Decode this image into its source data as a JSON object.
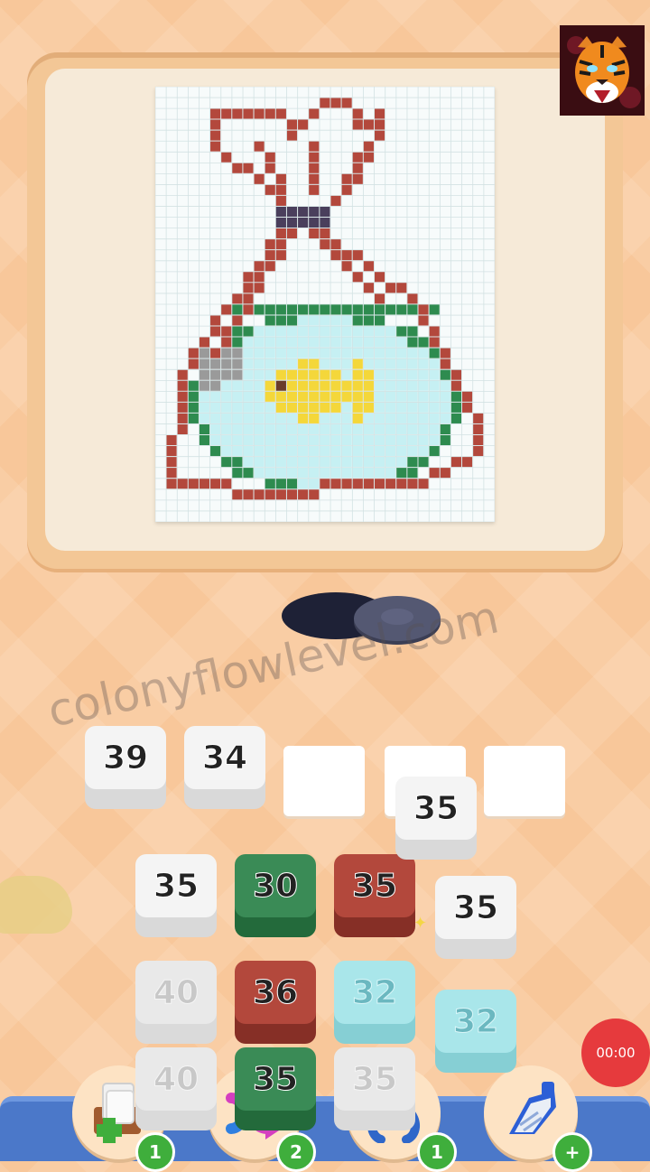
{
  "board": {
    "grid_cols": 31,
    "grid_rows": 40,
    "colors": {
      "background": "#f7fbfb",
      "outline": "#b3483c",
      "knot": "#4a3f5c",
      "water_edge": "#2e8b4f",
      "water": "#c6f0f3",
      "fish": "#f4d73a",
      "eye": "#6a3c2a",
      "question": "#9a9a9a"
    }
  },
  "avatar": {
    "icon": "tiger-icon"
  },
  "slots": [
    {
      "value": "39",
      "color": "white"
    },
    {
      "value": "34",
      "color": "white"
    },
    {
      "value": "",
      "color": "empty"
    },
    {
      "value": "",
      "color": "empty"
    },
    {
      "value": "",
      "color": "empty"
    }
  ],
  "floating_tile": {
    "value": "35",
    "color": "white"
  },
  "pile": {
    "row1": [
      {
        "value": "35",
        "color": "white"
      },
      {
        "value": "30",
        "color": "green"
      },
      {
        "value": "35",
        "color": "red"
      },
      {
        "value": "35",
        "color": "white"
      }
    ],
    "row2": [
      {
        "value": "40",
        "color": "light"
      },
      {
        "value": "36",
        "color": "red"
      },
      {
        "value": "32",
        "color": "cyan"
      },
      {
        "value": "32",
        "color": "cyan"
      }
    ],
    "row3": [
      {
        "value": "40",
        "color": "light"
      },
      {
        "value": "35",
        "color": "green"
      },
      {
        "value": "35",
        "color": "light"
      }
    ]
  },
  "watermark": "colonyflowlevel.com",
  "timer": "00:00",
  "boosters": [
    {
      "icon": "add-card-icon",
      "count": "1"
    },
    {
      "icon": "shuffle-icon",
      "count": "2"
    },
    {
      "icon": "magnet-claw-icon",
      "count": "1"
    },
    {
      "icon": "vacuum-icon",
      "count": "+"
    }
  ]
}
